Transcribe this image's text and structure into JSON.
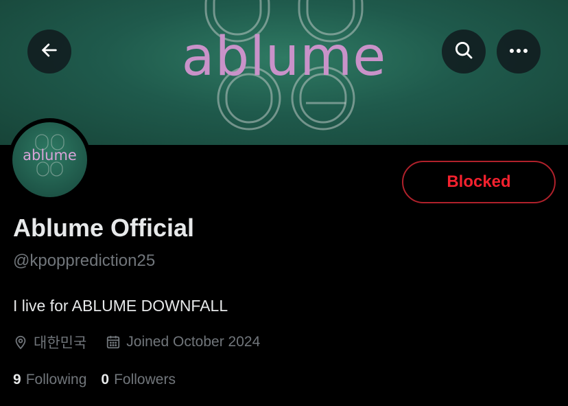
{
  "banner": {
    "logo_text": "ablume"
  },
  "avatar": {
    "logo_text": "ablume"
  },
  "header_actions": {
    "back": "arrow-left-icon",
    "search": "search-icon",
    "more": "more-horizontal-icon"
  },
  "profile": {
    "display_name": "Ablume Official",
    "handle": "@kpopprediction25",
    "bio": "I live for ABLUME DOWNFALL",
    "location": "대한민국",
    "joined": "Joined October 2024",
    "following_count": "9",
    "following_label": "Following",
    "followers_count": "0",
    "followers_label": "Followers"
  },
  "actions": {
    "blocked_label": "Blocked"
  },
  "colors": {
    "background": "#000000",
    "text_primary": "#e7e9ea",
    "text_secondary": "#71767b",
    "blocked_red": "#f4212e",
    "banner_green": "#1f5a4c",
    "logo_pink": "#c992c9"
  }
}
